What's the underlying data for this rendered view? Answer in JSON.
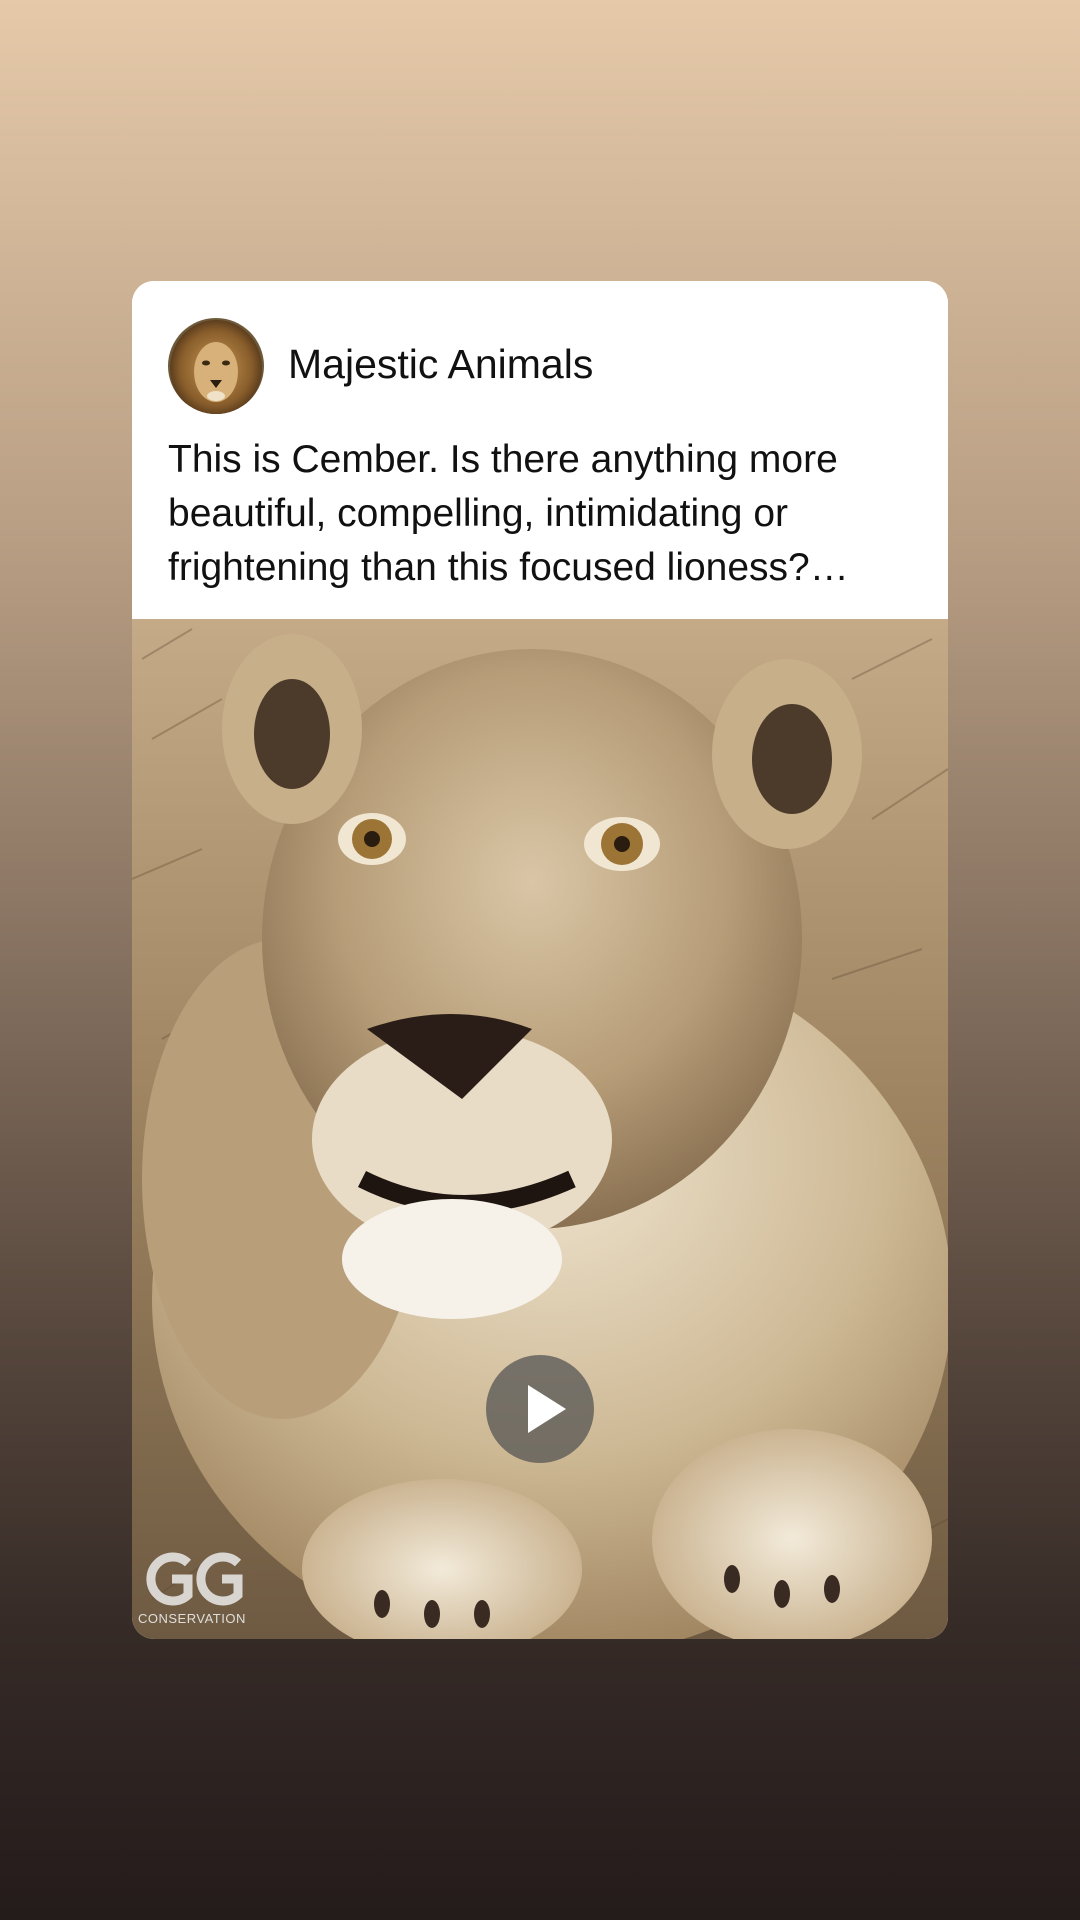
{
  "post": {
    "page_name": "Majestic Animals",
    "caption": "This is Cember. Is there anything more\nbeautiful, compelling, intimidating or\nfrightening than this focused lioness?…",
    "avatar_icon": "lion-avatar",
    "media": {
      "type": "video",
      "play_icon": "play-icon",
      "watermark_text": "CONSERVATION"
    }
  },
  "colors": {
    "background_top": "#e5c9a9",
    "background_bottom": "#241b1b",
    "card": "#ffffff",
    "text": "#111111"
  }
}
